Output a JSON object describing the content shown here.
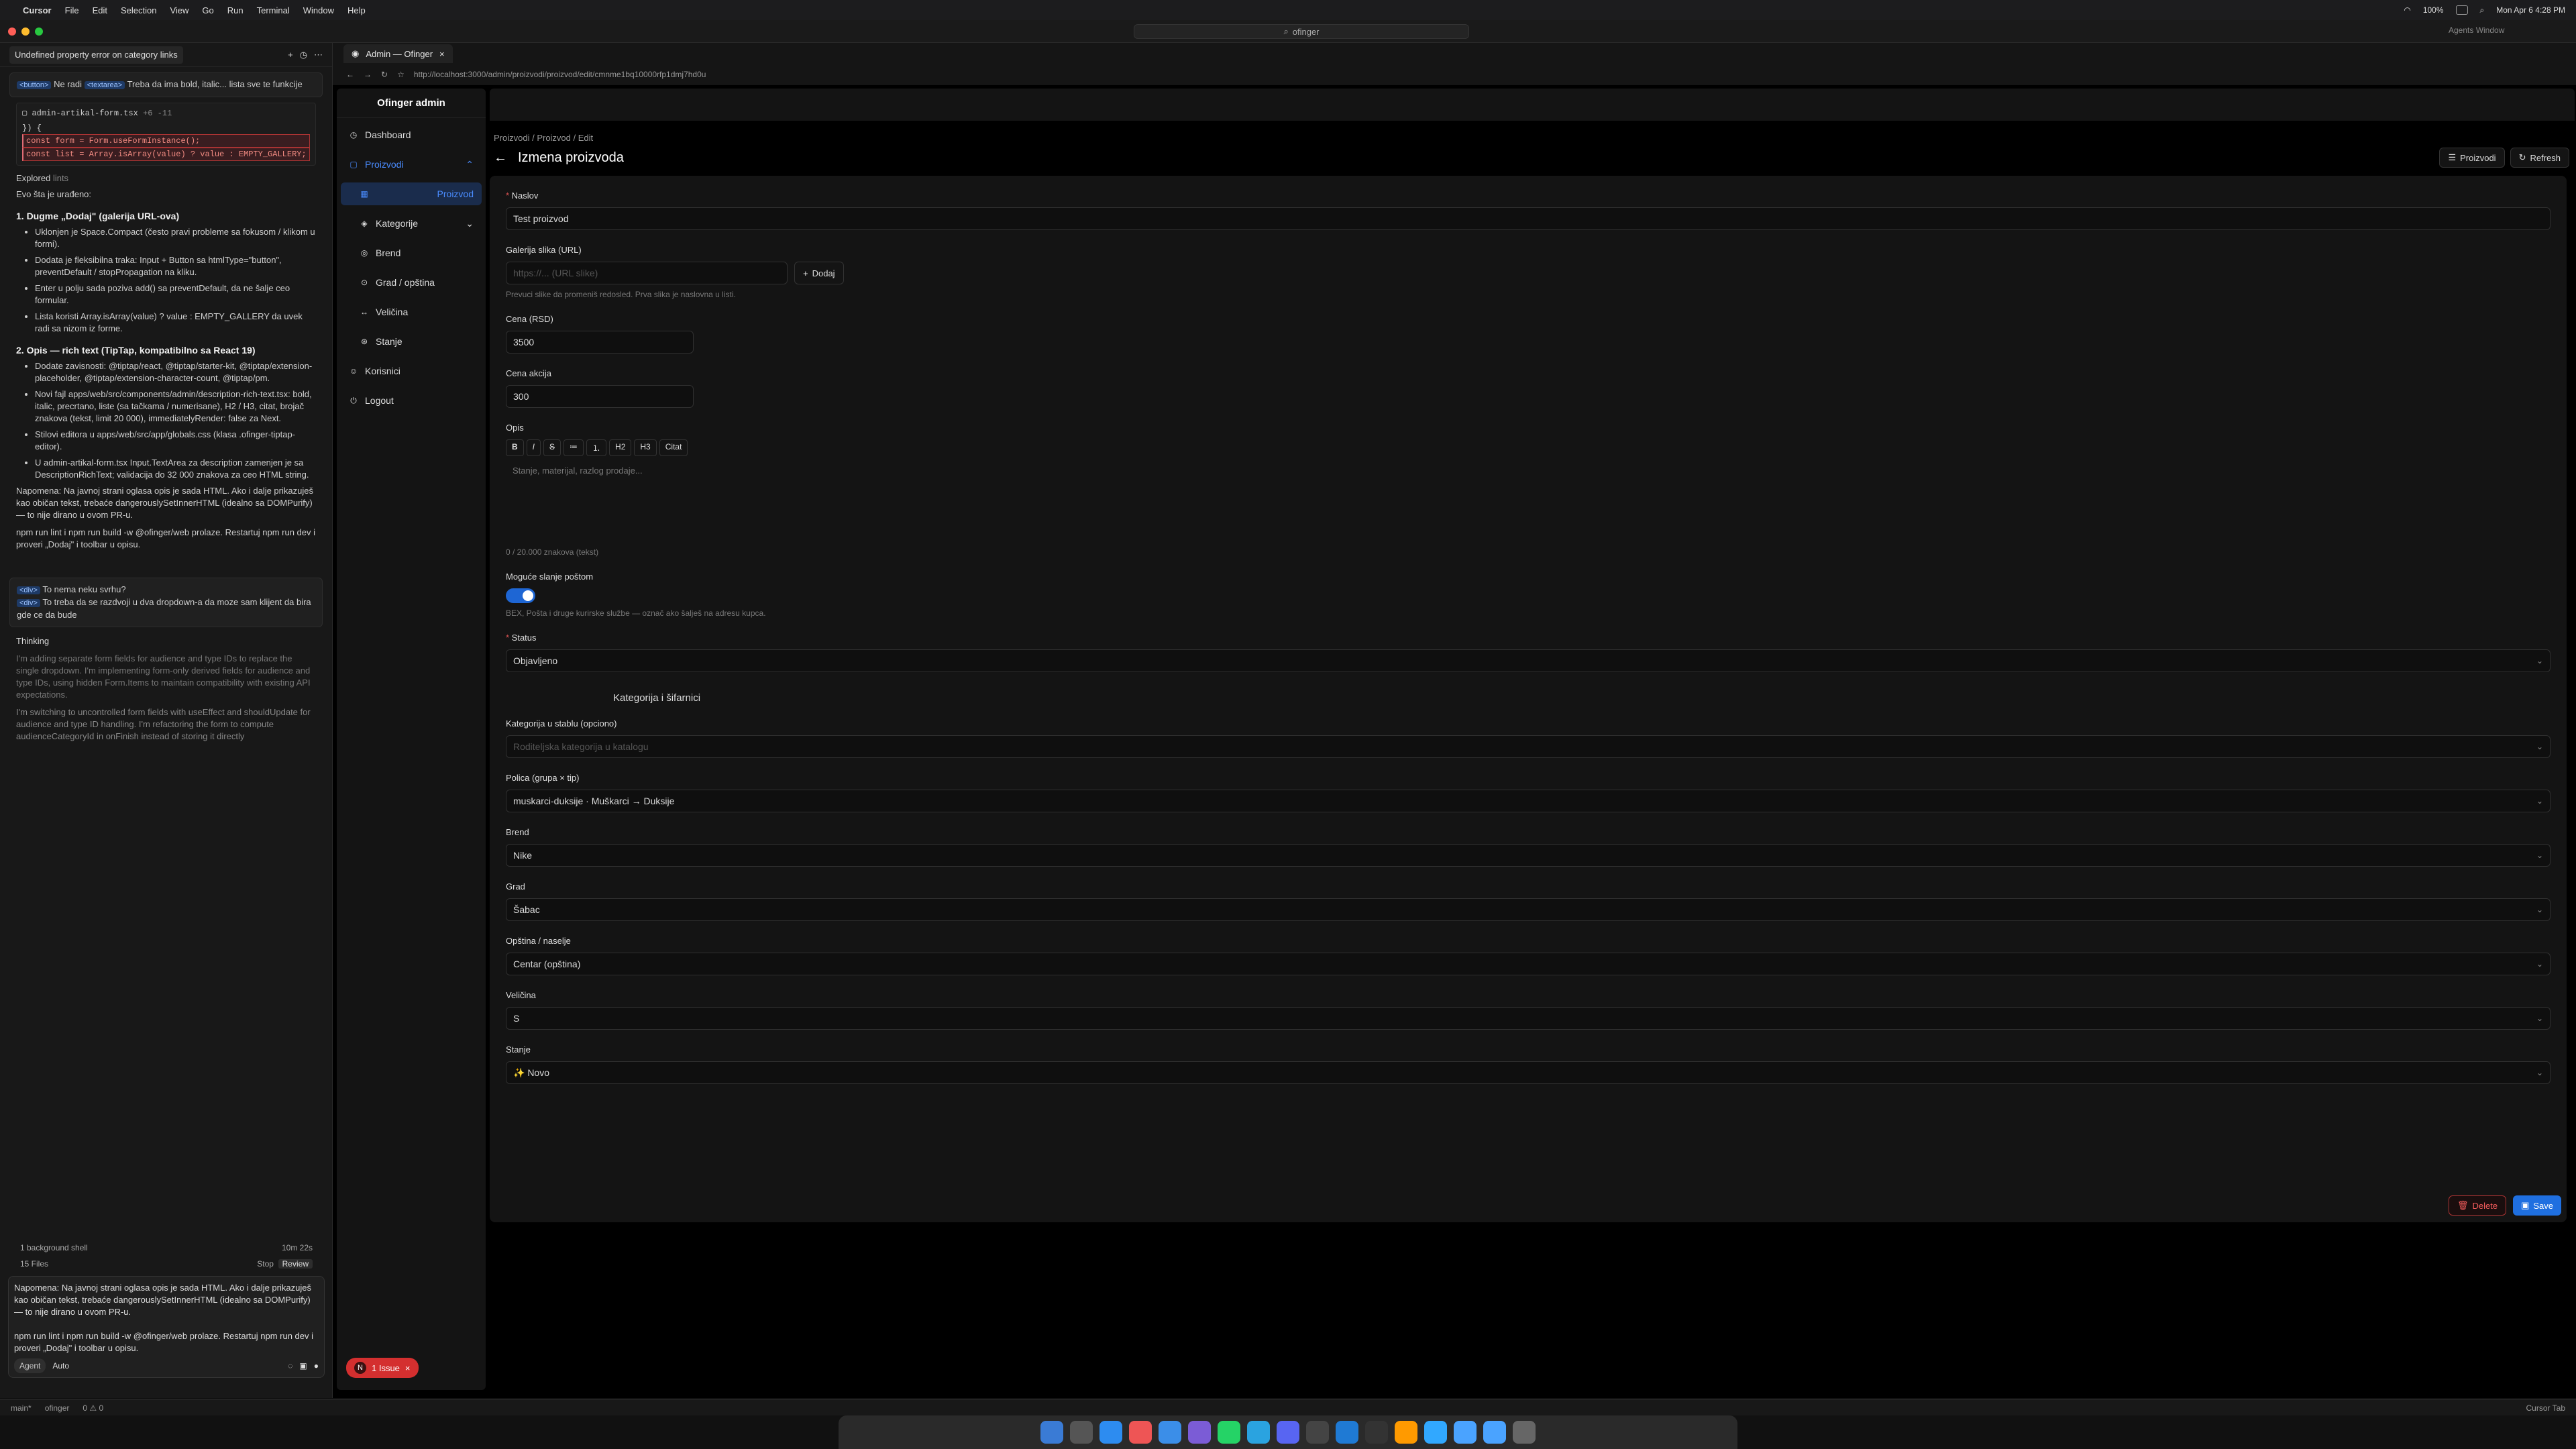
{
  "menubar": {
    "app": "Cursor",
    "items": [
      "File",
      "Edit",
      "Selection",
      "View",
      "Go",
      "Run",
      "Terminal",
      "Window",
      "Help"
    ],
    "battery": "100%",
    "datetime": "Mon Apr 6  4:28 PM"
  },
  "titlebar": {
    "search": "ofinger",
    "agents_window": "Agents Window"
  },
  "chat": {
    "tab_title": "Undefined property error on category links",
    "user_msg": {
      "chip1": "<button>",
      "text1": "Ne radi",
      "chip2": "<textarea>",
      "text2": "Treba da ima bold, italic... lista sve te funkcije"
    },
    "code_file": "admin-artikal-form.tsx",
    "code_diff": "+6 -11",
    "code_lines": [
      "}) {",
      "const form = Form.useFormInstance();",
      "const list = Array.isArray(value) ? value : EMPTY_GALLERY;"
    ],
    "explored": "Explored",
    "explored_val": "lints",
    "intro": "Evo šta je urađeno:",
    "h1": "1. Dugme „Dodaj\" (galerija URL-ova)",
    "list1": [
      "Uklonjen je Space.Compact (često pravi probleme sa fokusom / klikom u formi).",
      "Dodata je fleksibilna traka: Input + Button sa htmlType=\"button\", preventDefault / stopPropagation na kliku.",
      "Enter u polju sada poziva add() sa preventDefault, da ne šalje ceo formular.",
      "Lista koristi Array.isArray(value) ? value : EMPTY_GALLERY da uvek radi sa nizom iz forme."
    ],
    "h2": "2. Opis — rich text (TipTap, kompatibilno sa React 19)",
    "list2": [
      "Dodate zavisnosti: @tiptap/react, @tiptap/starter-kit, @tiptap/extension-placeholder, @tiptap/extension-character-count, @tiptap/pm.",
      "Novi fajl apps/web/src/components/admin/description-rich-text.tsx: bold, italic, precrtano, liste (sa tačkama / numerisane), H2 / H3, citat, brojač znakova (tekst, limit 20 000), immediatelyRender: false za Next.",
      "Stilovi editora u apps/web/src/app/globals.css (klasa .ofinger-tiptap-editor).",
      "U admin-artikal-form.tsx Input.TextArea za description zamenjen je sa DescriptionRichText; validacija do 32 000 znakova za ceo HTML string."
    ],
    "note": "Napomena: Na javnoj strani oglasa opis je sada HTML. Ako i dalje prikazuješ kao običan tekst, trebaće dangerouslySetInnerHTML (idealno sa DOMPurify) — to nije dirano u ovom PR-u.",
    "cmd": "npm run lint i npm run build -w @ofinger/web prolaze. Restartuj npm run dev i proveri „Dodaj\" i toolbar u opisu.",
    "user_msg2": {
      "chip1": "<div>",
      "text1": "To nema neku svrhu?",
      "chip2": "<div>",
      "text2": "To treba da se razdvoji u dva dropdown-a da moze sam klijent da bira gde ce da bude"
    },
    "thinking": "Thinking",
    "think1": "I'm adding separate form fields for audience and type IDs to replace the single dropdown. I'm implementing form-only derived fields for audience and type IDs, using hidden Form.Items to maintain compatibility with existing API expectations.",
    "think2": "I'm switching to uncontrolled form fields with useEffect and shouldUpdate for audience and type ID handling. I'm refactoring the form to compute audienceCategoryId in onFinish instead of storing it directly",
    "bg_shell": "1 background shell",
    "bg_time": "10m 22s",
    "files": "15 Files",
    "stop": "Stop",
    "review": "Review",
    "composer": "Napomena: Na javnoj strani oglasa opis je sada HTML. Ako i dalje prikazuješ kao običan tekst, trebaće dangerouslySetInnerHTML (idealno sa DOMPurify) — to nije dirano u ovom PR-u.\n\nnpm run lint i npm run build -w @ofinger/web prolaze. Restartuj npm run dev i proveri „Dodaj\" i toolbar u opisu.",
    "agent": "Agent",
    "auto": "Auto"
  },
  "statusbar": {
    "branch": "main*",
    "project": "ofinger",
    "problems": "0 ⚠ 0",
    "right": "Cursor Tab"
  },
  "browser": {
    "tab": "Admin — Ofinger",
    "url": "http://localhost:3000/admin/proizvodi/proizvod/edit/cmnme1bq10000rfp1dmj7hd0u"
  },
  "admin": {
    "brand": "Ofinger admin",
    "nav": {
      "dashboard": "Dashboard",
      "proizvodi": "Proizvodi",
      "proizvod": "Proizvod",
      "kategorije": "Kategorije",
      "brend": "Brend",
      "grad": "Grad / opština",
      "velicina": "Veličina",
      "stanje": "Stanje",
      "korisnici": "Korisnici",
      "logout": "Logout"
    },
    "issue": "1 Issue",
    "issue_n": "N",
    "breadcrumb": {
      "a": "Proizvodi",
      "b": "Proizvod",
      "c": "Edit"
    },
    "title": "Izmena proizvoda",
    "btn_list": "Proizvodi",
    "btn_refresh": "Refresh",
    "form": {
      "naslov_l": "Naslov",
      "naslov_v": "Test proizvod",
      "gal_l": "Galerija slika (URL)",
      "gal_ph": "https://... (URL slike)",
      "gal_btn": "Dodaj",
      "gal_help": "Prevuci slike da promeniš redosled. Prva slika je naslovna u listi.",
      "cena_l": "Cena (RSD)",
      "cena_v": "3500",
      "akcija_l": "Cena akcija",
      "akcija_v": "300",
      "opis_l": "Opis",
      "tb": [
        "B",
        "I",
        "S",
        "≔",
        "⒈",
        "H2",
        "H3",
        "Citat"
      ],
      "opis_ph": "Stanje, materijal, razlog prodaje...",
      "opis_count": "0 / 20.000 znakova (tekst)",
      "posta_l": "Moguće slanje poštom",
      "posta_help": "BEX, Pošta i druge kurirske službe — označ ako šalješ na adresu kupca.",
      "status_l": "Status",
      "status_v": "Objavljeno",
      "section": "Kategorija i šifarnici",
      "kat_l": "Kategorija u stablu (opciono)",
      "kat_ph": "Roditeljska kategorija u katalogu",
      "polica_l": "Polica (grupa × tip)",
      "polica_v": "muskarci-duksije · Muškarci → Duksije",
      "brend_l": "Brend",
      "brend_v": "Nike",
      "grad_l": "Grad",
      "grad_v": "Šabac",
      "opstina_l": "Opština / naselje",
      "opstina_v": "Centar (opština)",
      "vel_l": "Veličina",
      "vel_v": "S",
      "stanje_l": "Stanje",
      "stanje_v": "✨ Novo",
      "delete": "Delete",
      "save": "Save"
    }
  }
}
